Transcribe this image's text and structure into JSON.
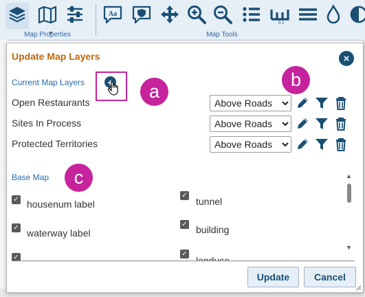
{
  "toolbar": {
    "groups": [
      {
        "label": "Map Properties",
        "buttons": [
          "layers-icon",
          "map-icon",
          "sliders-icon"
        ]
      },
      {
        "label": "Map Tools",
        "buttons": [
          "label-aa-icon",
          "shield-icon",
          "move-arrows-icon",
          "zoom-in-icon",
          "zoom-out-icon",
          "list-icon",
          "measure-ruler-icon",
          "menu-lines-icon",
          "water-drop-icon",
          "contrast-icon"
        ]
      }
    ]
  },
  "dialog": {
    "title": "Update Map Layers",
    "close_glyph": "×",
    "current_layers_label": "Current Map Layers",
    "add_glyph": "+",
    "layers": [
      {
        "name": "Open Restaurants",
        "position": "Above Roads"
      },
      {
        "name": "Sites In Process",
        "position": "Above Roads"
      },
      {
        "name": "Protected Territories",
        "position": "Above Roads"
      }
    ],
    "base_map_label": "Base Map",
    "base_map_items": [
      {
        "label": "housenum label",
        "checked": true
      },
      {
        "label": "tunnel",
        "checked": true
      },
      {
        "label": "waterway label",
        "checked": true
      },
      {
        "label": "building",
        "checked": true
      },
      {
        "label": "",
        "checked": true
      },
      {
        "label": "landuse",
        "checked": true
      }
    ],
    "update_label": "Update",
    "cancel_label": "Cancel"
  },
  "annotations": [
    "a",
    "b",
    "c"
  ],
  "colors": {
    "title": "#c0660b",
    "accent": "#1a4f73",
    "link": "#2a6aa8",
    "annotation": "#c6239c"
  }
}
